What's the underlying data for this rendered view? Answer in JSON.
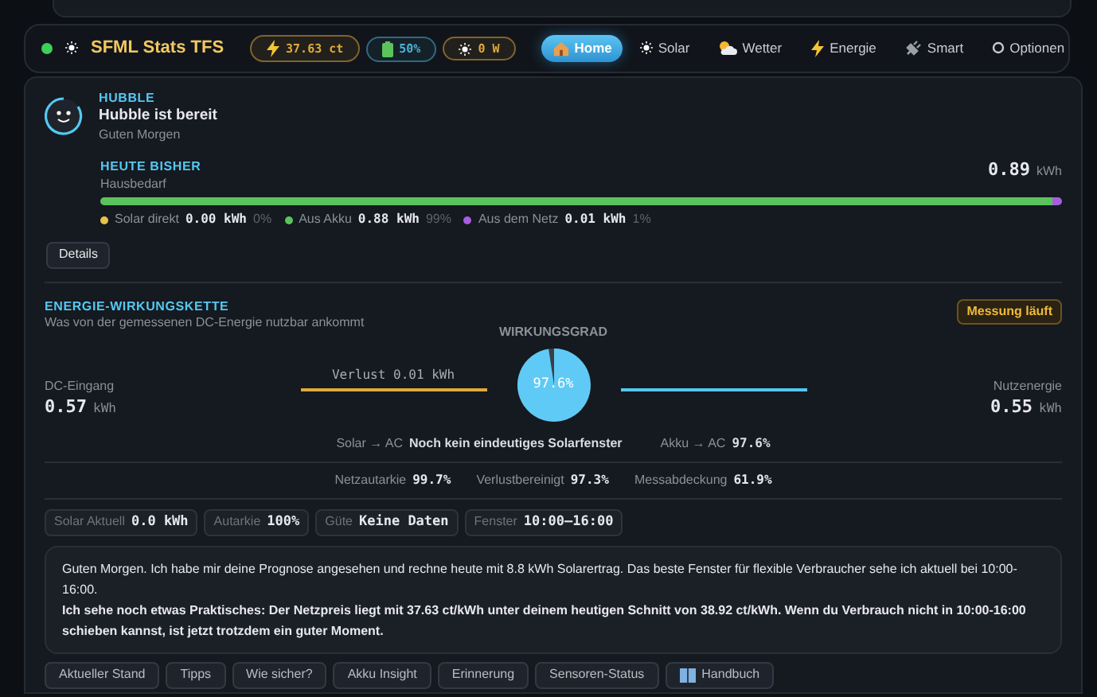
{
  "header": {
    "online": true,
    "title": "SFML Stats TFS",
    "pills": [
      {
        "kind": "price",
        "value": "37.63 ct",
        "color": "#e0a93a"
      },
      {
        "kind": "battery",
        "value": "50%",
        "color": "#4ab3d9"
      },
      {
        "kind": "power",
        "value": "0 W",
        "color": "#e0a93a"
      }
    ],
    "tabs": [
      {
        "label": "Home",
        "selected": true
      },
      {
        "label": "Solar",
        "selected": false
      },
      {
        "label": "Wetter",
        "selected": false
      },
      {
        "label": "Energie",
        "selected": false
      },
      {
        "label": "Smart",
        "selected": false
      },
      {
        "label": "Optionen",
        "selected": false
      }
    ]
  },
  "assistant": {
    "name": "HUBBLE",
    "status": "Hubble ist bereit",
    "greeting": "Guten Morgen"
  },
  "today": {
    "title": "HEUTE BISHER",
    "subtitle": "Hausbedarf",
    "value": "0.89",
    "unit": "kWh",
    "segments": [
      {
        "label": "Solar direkt",
        "value": "0.00",
        "unit": "kWh",
        "share": "0%",
        "color": "#e8c14a"
      },
      {
        "label": "Aus Akku",
        "value": "0.88",
        "unit": "kWh",
        "share": "99%",
        "level": 0.99,
        "color": "#5bc35b"
      },
      {
        "label": "Aus dem Netz",
        "value": "0.01",
        "unit": "kWh",
        "share": "1%",
        "level": 0.01,
        "color": "#a55ee0"
      }
    ],
    "details_button": "Details"
  },
  "chain": {
    "title": "ENERGIE-WIRKUNGSKETTE",
    "subtitle": "Was von der gemessenen DC-Energie nutzbar ankommt",
    "badge": "Messung läuft",
    "input": {
      "label": "DC-Eingang",
      "value": "0.57",
      "unit": "kWh"
    },
    "loss": "Verlust 0.01 kWh",
    "gauge_title": "WIRKUNGSGRAD",
    "gauge": {
      "reading": "97.6%"
    },
    "output": {
      "label": "Nutzenergie",
      "value": "0.55",
      "unit": "kWh"
    },
    "paths": [
      {
        "label": "Solar → AC",
        "value": "Noch kein eindeutiges Solarfenster",
        "kind": "text"
      },
      {
        "label": "Akku → AC",
        "value": "97.6%",
        "kind": "number"
      }
    ],
    "stats": [
      {
        "label": "Netzautarkie",
        "value": "99.7%"
      },
      {
        "label": "Verlustbereinigt",
        "value": "97.3%"
      },
      {
        "label": "Messabdeckung",
        "value": "61.9%"
      }
    ]
  },
  "chips": [
    {
      "label": "Solar Aktuell",
      "value": "0.0 kWh"
    },
    {
      "label": "Autarkie",
      "value": "100%"
    },
    {
      "label": "Güte",
      "value": "Keine Daten"
    },
    {
      "label": "Fenster",
      "value": "10:00–16:00"
    }
  ],
  "message": [
    "Guten Morgen. Ich habe mir deine Prognose angesehen und rechne heute mit 8.8 kWh Solarertrag. Das beste Fenster für flexible Verbraucher sehe ich aktuell bei 10:00-16:00.",
    "**Ich sehe noch etwas Praktisches: Der Netzpreis liegt mit 37.63 ct/kWh unter deinem heutigen Schnitt von 38.92 ct/kWh. Wenn du Verbrauch nicht in 10:00-16:00 schieben kannst, ist jetzt trotzdem ein guter Moment.**"
  ],
  "actions": [
    {
      "label": "Aktueller Stand"
    },
    {
      "label": "Tipps"
    },
    {
      "label": "Wie sicher?"
    },
    {
      "label": "Akku Insight"
    },
    {
      "label": "Erinnerung"
    },
    {
      "label": "Sensoren-Status"
    },
    {
      "label": "Handbuch",
      "kind": "manual"
    }
  ]
}
